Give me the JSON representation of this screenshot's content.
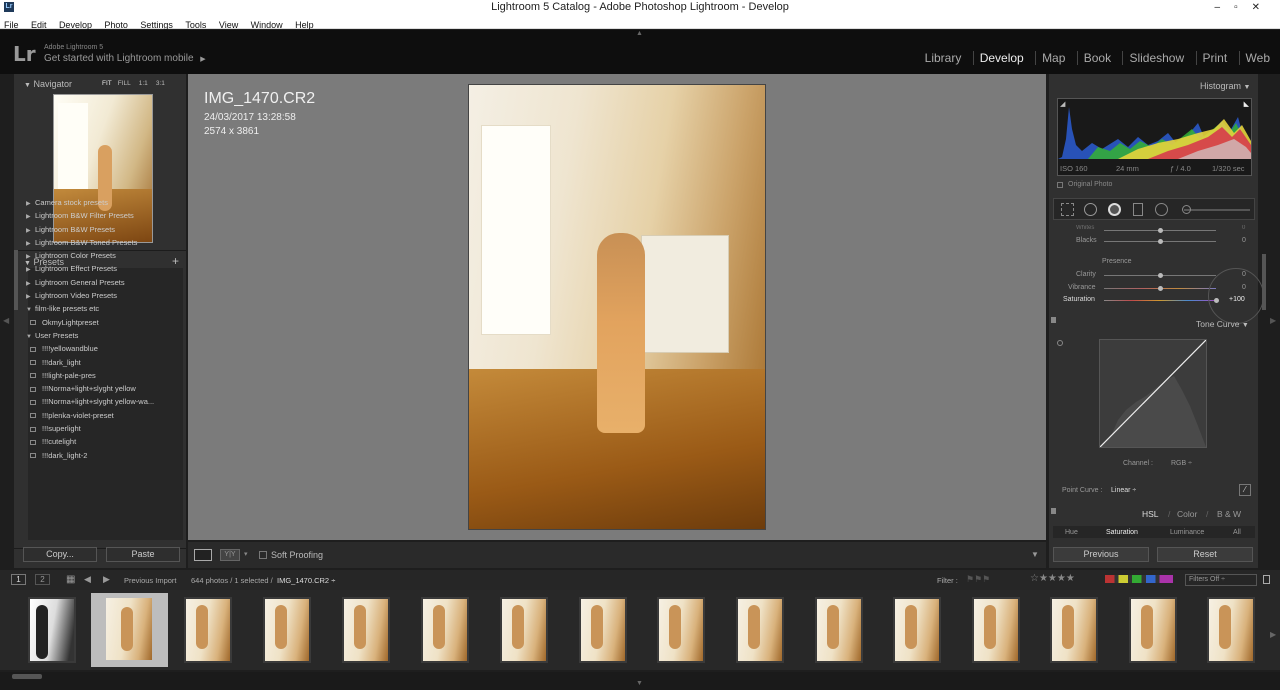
{
  "window": {
    "title": "Lightroom 5 Catalog - Adobe Photoshop Lightroom - Develop",
    "app_icon": "Lr"
  },
  "menu": [
    "File",
    "Edit",
    "Develop",
    "Photo",
    "Settings",
    "Tools",
    "View",
    "Window",
    "Help"
  ],
  "identity": {
    "logo": "Lr",
    "line1": "Adobe Lightroom 5",
    "line2": "Get started with Lightroom mobile",
    "arrow": "▶"
  },
  "modules": [
    "Library",
    "Develop",
    "Map",
    "Book",
    "Slideshow",
    "Print",
    "Web"
  ],
  "active_module": "Develop",
  "navigator": {
    "title": "Navigator",
    "zoom": [
      "FIT",
      "FILL",
      "1:1",
      "3:1"
    ]
  },
  "presets": {
    "title": "Presets",
    "add": "+",
    "items": [
      {
        "label": "Camera stock presets",
        "kind": "folder",
        "open": false
      },
      {
        "label": "Lightroom B&W Filter Presets",
        "kind": "folder",
        "open": false
      },
      {
        "label": "Lightroom B&W Presets",
        "kind": "folder",
        "open": false
      },
      {
        "label": "Lightroom B&W Toned Presets",
        "kind": "folder",
        "open": false
      },
      {
        "label": "Lightroom Color Presets",
        "kind": "folder",
        "open": false
      },
      {
        "label": "Lightroom Effect Presets",
        "kind": "folder",
        "open": false
      },
      {
        "label": "Lightroom General Presets",
        "kind": "folder",
        "open": false
      },
      {
        "label": "Lightroom Video Presets",
        "kind": "folder",
        "open": false
      },
      {
        "label": "film-like presets etc",
        "kind": "folder",
        "open": true
      },
      {
        "label": "OkmyLightpreset",
        "kind": "preset"
      },
      {
        "label": "User Presets",
        "kind": "folder",
        "open": true
      },
      {
        "label": "!!!!yellowandblue",
        "kind": "preset"
      },
      {
        "label": "!!!dark_light",
        "kind": "preset"
      },
      {
        "label": "!!!light-pale-pres",
        "kind": "preset"
      },
      {
        "label": "!!!Norma+light+slyght yellow",
        "kind": "preset"
      },
      {
        "label": "!!!Norma+light+slyght yellow-wa...",
        "kind": "preset"
      },
      {
        "label": "!!!plenka-violet-preset",
        "kind": "preset"
      },
      {
        "label": "!!!superlight",
        "kind": "preset"
      },
      {
        "label": "!!!cutelight",
        "kind": "preset"
      },
      {
        "label": "!!!dark_light-2",
        "kind": "preset"
      }
    ]
  },
  "left_buttons": {
    "copy": "Copy...",
    "paste": "Paste"
  },
  "image": {
    "name": "IMG_1470.CR2",
    "date": "24/03/2017 13:28:58",
    "dims": "2574 x 3861"
  },
  "toolbar": {
    "soft_proofing": "Soft Proofing"
  },
  "histogram": {
    "title": "Histogram",
    "iso": "ISO 160",
    "focal": "24 mm",
    "aperture": "ƒ / 4.0",
    "shutter": "1/320 sec",
    "original": "Original Photo"
  },
  "basic": {
    "whites_label": "Whites",
    "whites_value": "0",
    "blacks_label": "Blacks",
    "blacks_value": "0",
    "presence": "Presence",
    "clarity_label": "Clarity",
    "clarity_value": "0",
    "vibrance_label": "Vibrance",
    "vibrance_value": "0",
    "saturation_label": "Saturation",
    "saturation_value": "+100",
    "clarity_level": 0.5,
    "vibrance_level": 0.5,
    "saturation_level": 1.0,
    "whites_level": 0.5,
    "blacks_level": 0.5
  },
  "tone_curve": {
    "title": "Tone Curve",
    "channel_label": "Channel :",
    "channel_value": "RGB ÷",
    "point_label": "Point Curve :",
    "point_value": "Linear ÷"
  },
  "hsl": {
    "title": "HSL",
    "color": "Color",
    "bw": "B & W",
    "tabs": [
      "Hue",
      "Saturation",
      "Luminance",
      "All"
    ],
    "active_tab": "Saturation"
  },
  "right_buttons": {
    "previous": "Previous",
    "reset": "Reset"
  },
  "filmstrip": {
    "view1": "1",
    "view2": "2",
    "source": "Previous Import",
    "count": "644 photos / 1 selected /",
    "selected_file": "IMG_1470.CR2 ÷",
    "filter_label": "Filter :",
    "filters_off": "Filters Off ÷",
    "thumb_count": 16,
    "selected_index": 1
  },
  "colors": {
    "accent": "#e8e8e8",
    "panel": "#303030",
    "center": "#7b7b7b"
  }
}
